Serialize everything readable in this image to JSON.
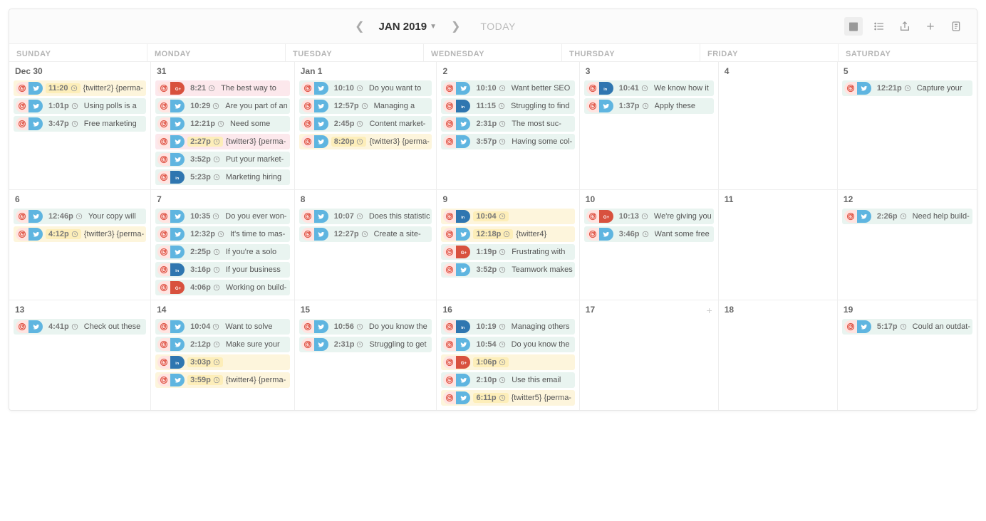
{
  "header": {
    "month": "JAN 2019",
    "today": "TODAY"
  },
  "dow": [
    "SUNDAY",
    "MONDAY",
    "TUESDAY",
    "WEDNESDAY",
    "THURSDAY",
    "FRIDAY",
    "SATURDAY"
  ],
  "days": [
    {
      "label": "Dec 30",
      "events": [
        {
          "net": "tw",
          "time": "11:20",
          "tl": "y",
          "text": "{twitter2} {perma-",
          "hl": "y"
        },
        {
          "net": "tw",
          "time": "1:01p",
          "text": "Using polls is a",
          "hl": "g"
        },
        {
          "net": "tw",
          "time": "3:47p",
          "text": "Free marketing",
          "hl": "g"
        }
      ]
    },
    {
      "label": "31",
      "events": [
        {
          "net": "gp",
          "time": "8:21",
          "text": "The best way to",
          "hl": "p"
        },
        {
          "net": "tw",
          "time": "10:29",
          "text": "Are you part of an",
          "hl": "g"
        },
        {
          "net": "tw",
          "time": "12:21p",
          "text": "Need some",
          "hl": "g"
        },
        {
          "net": "tw",
          "time": "2:27p",
          "tl": "y",
          "text": "{twitter3} {perma-",
          "hl": "p"
        },
        {
          "net": "tw",
          "time": "3:52p",
          "text": "Put your market-",
          "hl": "g"
        },
        {
          "net": "in",
          "time": "5:23p",
          "text": "Marketing hiring",
          "hl": "g"
        }
      ]
    },
    {
      "label": "Jan 1",
      "events": [
        {
          "net": "tw",
          "time": "10:10",
          "text": "Do you want to",
          "hl": "g"
        },
        {
          "net": "tw",
          "time": "12:57p",
          "text": "Managing a",
          "hl": "g"
        },
        {
          "net": "tw",
          "time": "2:45p",
          "text": "Content market-",
          "hl": "g"
        },
        {
          "net": "tw",
          "time": "8:20p",
          "tl": "y",
          "text": "{twitter3} {perma-",
          "hl": "y"
        }
      ]
    },
    {
      "label": "2",
      "events": [
        {
          "net": "tw",
          "time": "10:10",
          "text": "Want better SEO",
          "hl": "g"
        },
        {
          "net": "in",
          "time": "11:15",
          "text": "Struggling to find",
          "hl": "g"
        },
        {
          "net": "tw",
          "time": "2:31p",
          "text": "The most suc-",
          "hl": "g"
        },
        {
          "net": "tw",
          "time": "3:57p",
          "text": "Having some col-",
          "hl": "g"
        }
      ]
    },
    {
      "label": "3",
      "events": [
        {
          "net": "in",
          "time": "10:41",
          "text": "We know how it",
          "hl": "g"
        },
        {
          "net": "tw",
          "time": "1:37p",
          "text": "Apply these",
          "hl": "g"
        }
      ]
    },
    {
      "label": "4",
      "events": []
    },
    {
      "label": "5",
      "events": [
        {
          "net": "tw",
          "time": "12:21p",
          "text": "Capture your",
          "hl": "g"
        }
      ]
    },
    {
      "label": "6",
      "events": [
        {
          "net": "tw",
          "time": "12:46p",
          "text": "Your copy will",
          "hl": "g"
        },
        {
          "net": "tw",
          "time": "4:12p",
          "tl": "y",
          "text": "{twitter3} {perma-",
          "hl": "y"
        }
      ]
    },
    {
      "label": "7",
      "events": [
        {
          "net": "tw",
          "time": "10:35",
          "text": "Do you ever won-",
          "hl": "g"
        },
        {
          "net": "tw",
          "time": "12:32p",
          "text": "It's time to mas-",
          "hl": "g"
        },
        {
          "net": "tw",
          "time": "2:25p",
          "text": "If you're a solo",
          "hl": "g"
        },
        {
          "net": "in",
          "time": "3:16p",
          "text": "If your business",
          "hl": "g"
        },
        {
          "net": "gp",
          "time": "4:06p",
          "text": "Working on build-",
          "hl": "g"
        }
      ]
    },
    {
      "label": "8",
      "events": [
        {
          "net": "tw",
          "time": "10:07",
          "text": "Does this statistic",
          "hl": "g"
        },
        {
          "net": "tw",
          "time": "12:27p",
          "text": "Create a site-",
          "hl": "g"
        }
      ]
    },
    {
      "label": "9",
      "events": [
        {
          "net": "in",
          "time": "10:04",
          "tl": "y",
          "text": "",
          "hl": "y"
        },
        {
          "net": "tw",
          "time": "12:18p",
          "tl": "y",
          "text": "{twitter4}",
          "hl": "y"
        },
        {
          "net": "gp",
          "time": "1:19p",
          "text": "Frustrating with",
          "hl": "g"
        },
        {
          "net": "tw",
          "time": "3:52p",
          "text": "Teamwork makes",
          "hl": "g"
        }
      ]
    },
    {
      "label": "10",
      "events": [
        {
          "net": "gp",
          "time": "10:13",
          "text": "We're giving you",
          "hl": "g"
        },
        {
          "net": "tw",
          "time": "3:46p",
          "text": "Want some free",
          "hl": "g"
        }
      ]
    },
    {
      "label": "11",
      "events": []
    },
    {
      "label": "12",
      "events": [
        {
          "net": "tw",
          "time": "2:26p",
          "text": "Need help build-",
          "hl": "g"
        }
      ]
    },
    {
      "label": "13",
      "events": [
        {
          "net": "tw",
          "time": "4:41p",
          "text": "Check out these",
          "hl": "g"
        }
      ]
    },
    {
      "label": "14",
      "events": [
        {
          "net": "tw",
          "time": "10:04",
          "text": "Want to solve",
          "hl": "g"
        },
        {
          "net": "tw",
          "time": "2:12p",
          "text": "Make sure your",
          "hl": "g"
        },
        {
          "net": "in",
          "time": "3:03p",
          "tl": "y",
          "text": "",
          "hl": "y"
        },
        {
          "net": "tw",
          "time": "3:59p",
          "tl": "y",
          "text": "{twitter4} {perma-",
          "hl": "y"
        }
      ]
    },
    {
      "label": "15",
      "events": [
        {
          "net": "tw",
          "time": "10:56",
          "text": "Do you know the",
          "hl": "g"
        },
        {
          "net": "tw",
          "time": "2:31p",
          "text": "Struggling to get",
          "hl": "g"
        }
      ]
    },
    {
      "label": "16",
      "events": [
        {
          "net": "in",
          "time": "10:19",
          "text": "Managing others",
          "hl": "g"
        },
        {
          "net": "tw",
          "time": "10:54",
          "text": "Do you know the",
          "hl": "g"
        },
        {
          "net": "gp",
          "time": "1:06p",
          "tl": "y",
          "text": "",
          "hl": "y"
        },
        {
          "net": "tw",
          "time": "2:10p",
          "text": "Use this email",
          "hl": "g"
        },
        {
          "net": "tw",
          "time": "6:11p",
          "tl": "y",
          "text": "{twitter5} {perma-",
          "hl": "y"
        }
      ]
    },
    {
      "label": "17",
      "events": [],
      "add": true
    },
    {
      "label": "18",
      "events": []
    },
    {
      "label": "19",
      "events": [
        {
          "net": "tw",
          "time": "5:17p",
          "text": "Could an outdat-",
          "hl": "g"
        }
      ]
    }
  ]
}
